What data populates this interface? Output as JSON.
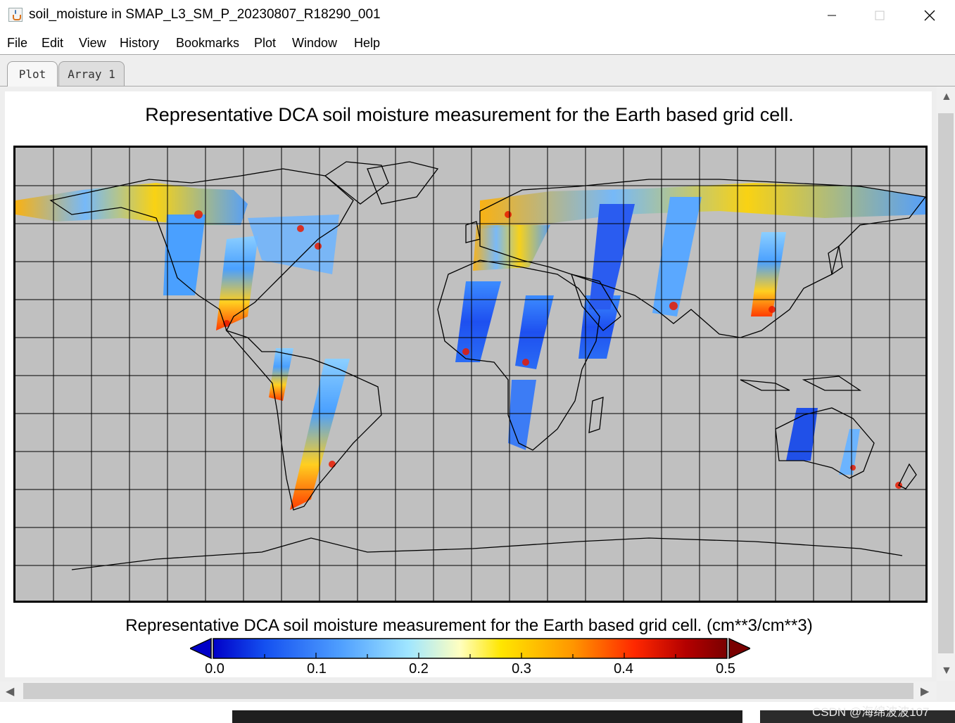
{
  "window": {
    "title": "soil_moisture in SMAP_L3_SM_P_20230807_R18290_001",
    "app_icon": "java-cup-icon",
    "controls": [
      "minimize-icon",
      "maximize-icon",
      "close-icon"
    ]
  },
  "menubar": {
    "items": [
      "File",
      "Edit",
      "View",
      "History",
      "Bookmarks",
      "Plot",
      "Window",
      "Help"
    ]
  },
  "tabs": [
    {
      "label": "Plot",
      "active": true
    },
    {
      "label": "Array 1",
      "active": false
    }
  ],
  "plot": {
    "title": "Representative DCA soil moisture measurement for the Earth based grid cell.",
    "map_projection": "equirectangular",
    "background_color": "#c0c0c0",
    "coastline_color": "#000000",
    "gridlines": true
  },
  "colorbar": {
    "label": "Representative DCA soil moisture measurement for the Earth based grid cell. (cm**3/cm**3)",
    "ticks": [
      "0.0",
      "0.1",
      "0.2",
      "0.3",
      "0.4",
      "0.5"
    ],
    "range": [
      0.0,
      0.5
    ],
    "colors": [
      "#0000c8",
      "#1450f0",
      "#50a0ff",
      "#a0e6ff",
      "#ffffc0",
      "#ffe600",
      "#ff9600",
      "#ff2800",
      "#b40000",
      "#7a0000"
    ],
    "under_color": "#0000c8",
    "over_color": "#7a0000"
  },
  "watermark": "CSDN @海绵波波107"
}
